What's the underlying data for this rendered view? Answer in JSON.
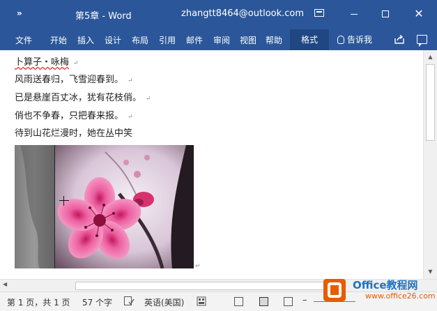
{
  "titlebar": {
    "qat_icon": "customize-quick-access-icon",
    "qat_glyph": "»",
    "doc_title": "第5章  -  Word",
    "account": "zhangtt8464@outlook.com",
    "close_glyph": "✕"
  },
  "ribbon": {
    "tabs": [
      "文件",
      "开始",
      "插入",
      "设计",
      "布局",
      "引用",
      "邮件",
      "审阅",
      "视图",
      "帮助"
    ],
    "contextual_tab": "格式",
    "tell_me": "告诉我"
  },
  "document": {
    "lines": [
      "卜算子・咏梅",
      "风雨送春归，飞雪迎春到。",
      "已是悬崖百丈冰，犹有花枝俏。",
      "俏也不争春，只把春来报。",
      "待到山花烂漫时，她在丛中笑"
    ],
    "paragraph_mark": "↵"
  },
  "statusbar": {
    "page": "第 1 页，共 1 页",
    "words": "57 个字",
    "language": "英语(美国)"
  },
  "watermark": {
    "name": "Office教程网",
    "url": "www.office26.com"
  },
  "colors": {
    "titlebar": "#2b579a",
    "contextual_tab": "#1f4782",
    "logo_orange": "#e65c00",
    "logo_blue": "#1e73be"
  }
}
